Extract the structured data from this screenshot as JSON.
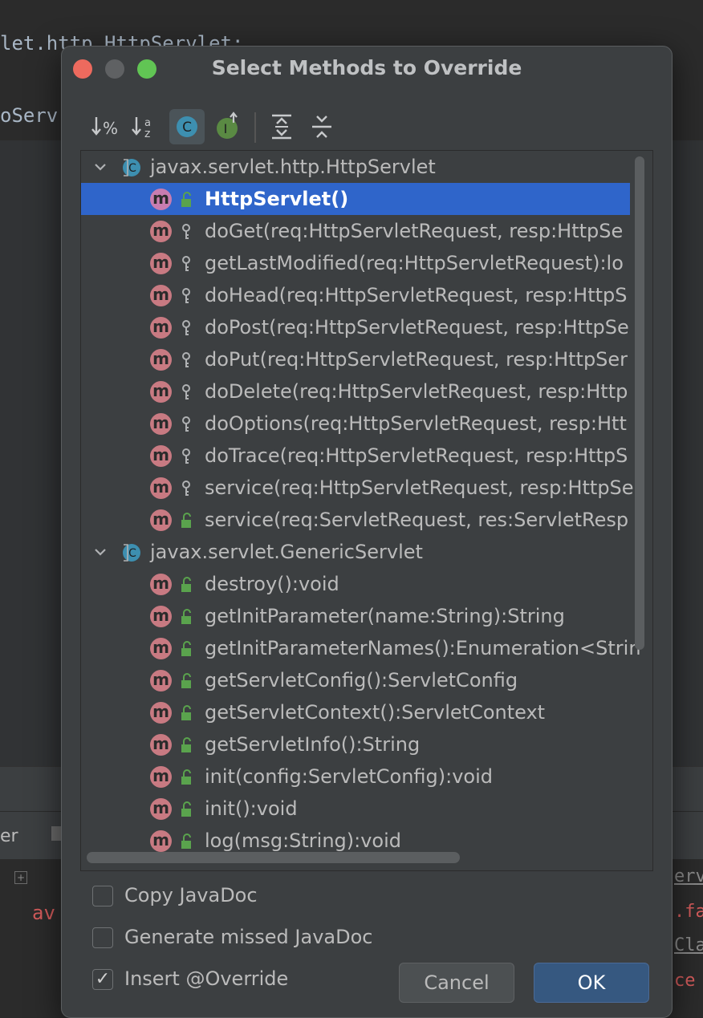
{
  "background": {
    "code_line_1": "let.http.HttpServlet;",
    "code_line_2": "oServ",
    "bottom_tab": "er",
    "bottom_red": "av",
    "right_snips": [
      "erv",
      ".fa",
      "Cla",
      "ce"
    ]
  },
  "dialog": {
    "title": "Select Methods to Override",
    "toolbar": [
      {
        "icon": "sort-by-visibility-icon"
      },
      {
        "icon": "sort-alphabetically-icon"
      },
      {
        "icon": "show-classes-icon",
        "active": true
      },
      {
        "icon": "show-interfaces-icon"
      },
      {
        "icon": "expand-all-icon"
      },
      {
        "icon": "collapse-all-icon"
      }
    ],
    "tree": [
      {
        "type": "class",
        "label": "javax.servlet.http.HttpServlet"
      },
      {
        "type": "method",
        "label": "HttpServlet()",
        "access": "public",
        "selected": true
      },
      {
        "type": "method",
        "label": "doGet(req:HttpServletRequest, resp:HttpSe",
        "access": "protected"
      },
      {
        "type": "method",
        "label": "getLastModified(req:HttpServletRequest):lo",
        "access": "protected"
      },
      {
        "type": "method",
        "label": "doHead(req:HttpServletRequest, resp:HttpS",
        "access": "protected"
      },
      {
        "type": "method",
        "label": "doPost(req:HttpServletRequest, resp:HttpSe",
        "access": "protected"
      },
      {
        "type": "method",
        "label": "doPut(req:HttpServletRequest, resp:HttpSer",
        "access": "protected"
      },
      {
        "type": "method",
        "label": "doDelete(req:HttpServletRequest, resp:Http",
        "access": "protected"
      },
      {
        "type": "method",
        "label": "doOptions(req:HttpServletRequest, resp:Htt",
        "access": "protected"
      },
      {
        "type": "method",
        "label": "doTrace(req:HttpServletRequest, resp:HttpS",
        "access": "protected"
      },
      {
        "type": "method",
        "label": "service(req:HttpServletRequest, resp:HttpSe",
        "access": "protected"
      },
      {
        "type": "method",
        "label": "service(req:ServletRequest, res:ServletResp",
        "access": "public"
      },
      {
        "type": "class",
        "label": "javax.servlet.GenericServlet"
      },
      {
        "type": "method",
        "label": "destroy():void",
        "access": "public"
      },
      {
        "type": "method",
        "label": "getInitParameter(name:String):String",
        "access": "public"
      },
      {
        "type": "method",
        "label": "getInitParameterNames():Enumeration<Strin",
        "access": "public"
      },
      {
        "type": "method",
        "label": "getServletConfig():ServletConfig",
        "access": "public"
      },
      {
        "type": "method",
        "label": "getServletContext():ServletContext",
        "access": "public"
      },
      {
        "type": "method",
        "label": "getServletInfo():String",
        "access": "public"
      },
      {
        "type": "method",
        "label": "init(config:ServletConfig):void",
        "access": "public"
      },
      {
        "type": "method",
        "label": "init():void",
        "access": "public"
      },
      {
        "type": "method",
        "label": "log(msg:String):void",
        "access": "public"
      }
    ],
    "options": [
      {
        "label": "Copy JavaDoc",
        "checked": false
      },
      {
        "label": "Generate missed JavaDoc",
        "checked": false
      },
      {
        "label": "Insert @Override",
        "checked": true
      }
    ],
    "cancel_label": "Cancel",
    "ok_label": "OK"
  },
  "colors": {
    "selection": "#2f65ca",
    "method_icon": "#c87a82",
    "class_icon": "#3d8fb0",
    "public_lock": "#5aa34d"
  }
}
